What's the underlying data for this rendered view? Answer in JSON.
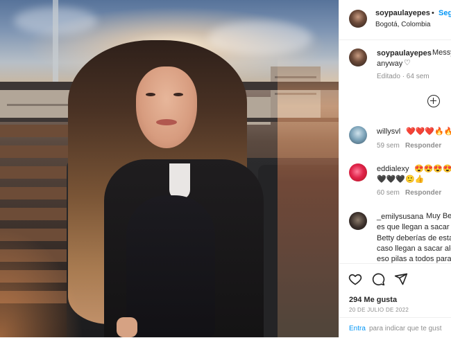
{
  "post": {
    "author": "soypaulayepes",
    "follow_label": "Seg",
    "separator": "•",
    "location": "Bogotá, Colombia",
    "caption_start": "Messy",
    "caption_line2": "anyway",
    "caption_meta": "Editado · 64 sem",
    "likes": "294 Me gusta",
    "date": "20 DE JULIO DE 2022"
  },
  "comments": [
    {
      "user": "willysvl",
      "text": "❤️❤️❤️🔥🔥",
      "time": "59 sem",
      "reply": "Responder"
    },
    {
      "user": "eddialexy",
      "text": "😍😍😍😍",
      "text2": "🖤🖤🖤🙂👍",
      "time": "60 sem",
      "reply": "Responder"
    },
    {
      "user": "_emilysusana",
      "text": "Muy Be",
      "lines": [
        "es que llegan a sacar",
        "Betty deberías de esta",
        "caso llegan a sacar alc",
        "eso pilas a todos para"
      ]
    }
  ],
  "comment_box": {
    "enter": "Entra",
    "placeholder": "para indicar que te gust"
  },
  "icons": [
    "heart-icon",
    "comment-icon",
    "share-icon",
    "add-circle-icon",
    "small-heart-icon"
  ]
}
